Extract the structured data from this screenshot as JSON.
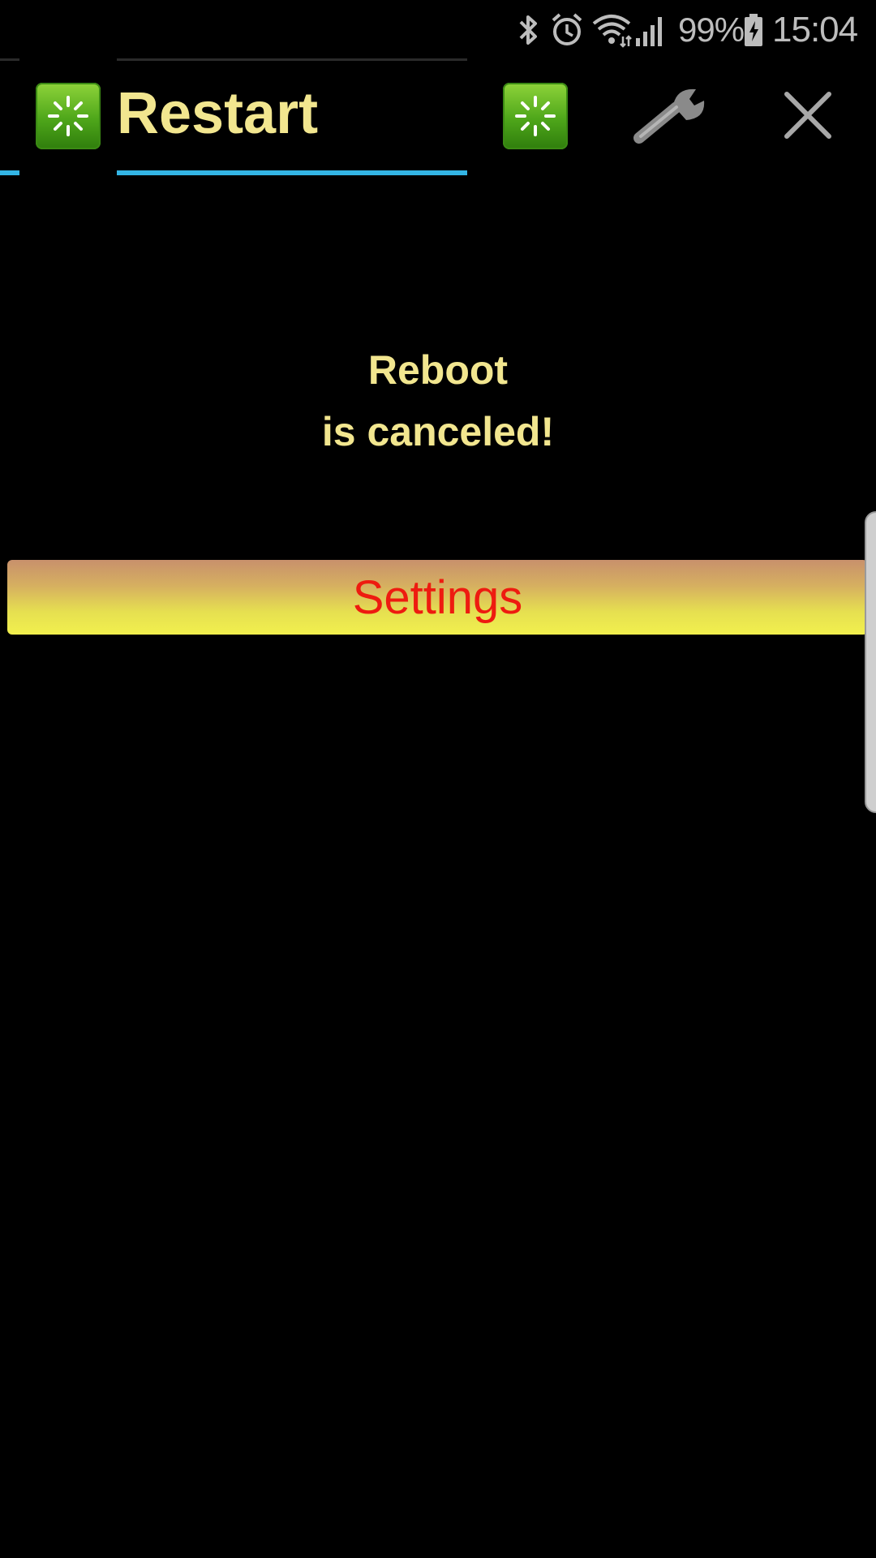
{
  "status_bar": {
    "battery_percent": "99%",
    "time": "15:04",
    "icons": [
      "bluetooth-icon",
      "alarm-icon",
      "wifi-icon",
      "signal-icon",
      "battery-charging-icon"
    ],
    "icon_color": "#bdbdbd"
  },
  "action_bar": {
    "active_tab": {
      "label": "Restart",
      "icon": "restart-app-icon"
    },
    "actions": [
      "wrench-icon",
      "close-icon"
    ],
    "indicator_color": "#33b5e5"
  },
  "main": {
    "message_line1": "Reboot",
    "message_line2": "is canceled!",
    "settings_button_label": "Settings"
  },
  "colors": {
    "title_text": "#f2e68f",
    "button_text": "#ee1b10",
    "background": "#000000"
  }
}
